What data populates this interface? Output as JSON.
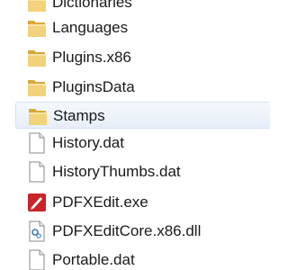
{
  "file_list": {
    "items": [
      {
        "name": "Dictionaries",
        "type": "folder",
        "icon": "folder-icon",
        "selected": false
      },
      {
        "name": "Languages",
        "type": "folder",
        "icon": "folder-icon",
        "selected": false
      },
      {
        "name": "Plugins.x86",
        "type": "folder",
        "icon": "folder-icon",
        "selected": false
      },
      {
        "name": "PluginsData",
        "type": "folder",
        "icon": "folder-icon",
        "selected": false
      },
      {
        "name": "Stamps",
        "type": "folder",
        "icon": "folder-icon",
        "selected": true
      },
      {
        "name": "History.dat",
        "type": "file",
        "icon": "file-icon",
        "selected": false
      },
      {
        "name": "HistoryThumbs.dat",
        "type": "file",
        "icon": "file-icon",
        "selected": false
      },
      {
        "name": "PDFXEdit.exe",
        "type": "exe",
        "icon": "pdfxedit-app-icon",
        "selected": false
      },
      {
        "name": "PDFXEditCore.x86.dll",
        "type": "dll",
        "icon": "dll-file-icon",
        "selected": false
      },
      {
        "name": "Portable.dat",
        "type": "file",
        "icon": "file-icon",
        "selected": false
      }
    ]
  },
  "colors": {
    "folder": "#e9c25a",
    "selection": "#e6eef8",
    "app_icon": "#c8242a"
  }
}
